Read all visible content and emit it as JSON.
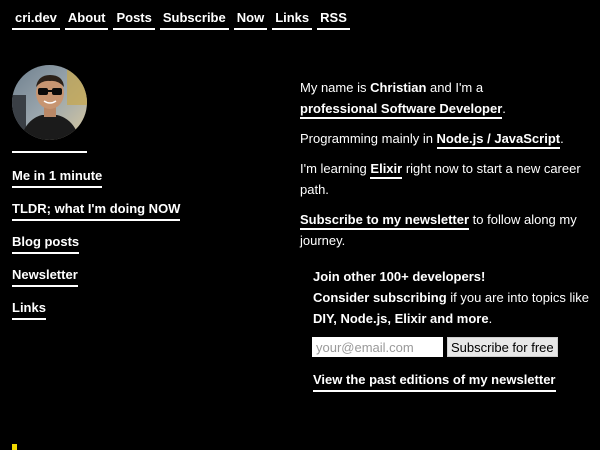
{
  "nav": {
    "items": [
      {
        "label": "cri.dev"
      },
      {
        "label": "About"
      },
      {
        "label": "Posts"
      },
      {
        "label": "Subscribe"
      },
      {
        "label": "Now"
      },
      {
        "label": "Links"
      },
      {
        "label": "RSS"
      }
    ]
  },
  "sidebar": {
    "avatar_icon": "person-photo",
    "items": [
      {
        "label": "Me in 1 minute"
      },
      {
        "label": "TLDR; what I'm doing NOW"
      },
      {
        "label": "Blog posts"
      },
      {
        "label": "Newsletter"
      },
      {
        "label": "Links"
      }
    ]
  },
  "intro": {
    "p1_a": "My name is ",
    "name": "Christian",
    "p1_b": " and I'm a",
    "role_link": "professional Software Developer",
    "p1_c": ".",
    "p2_a": "Programming mainly in ",
    "lang_link": "Node.js / JavaScript",
    "p2_b": ".",
    "p3_a": "I'm learning ",
    "elixir_link": "Elixir",
    "p3_b": " right now to start a new career path.",
    "subscribe_link": "Subscribe to my newsletter",
    "p4_b": " to follow along my journey."
  },
  "newsletter": {
    "headline": "Join other 100+ developers!",
    "consider": "Consider subscribing",
    "consider_rest": " if you are into topics like",
    "topics": "DIY, Node.js, Elixir and more",
    "topics_end": ".",
    "email_placeholder": "your@email.com",
    "email_value": "",
    "submit_label": "Subscribe for free",
    "past_link": "View the past editions of my newsletter"
  },
  "colors": {
    "background": "#000000",
    "text": "#ffffff",
    "accent_mark": "#f2d900"
  }
}
